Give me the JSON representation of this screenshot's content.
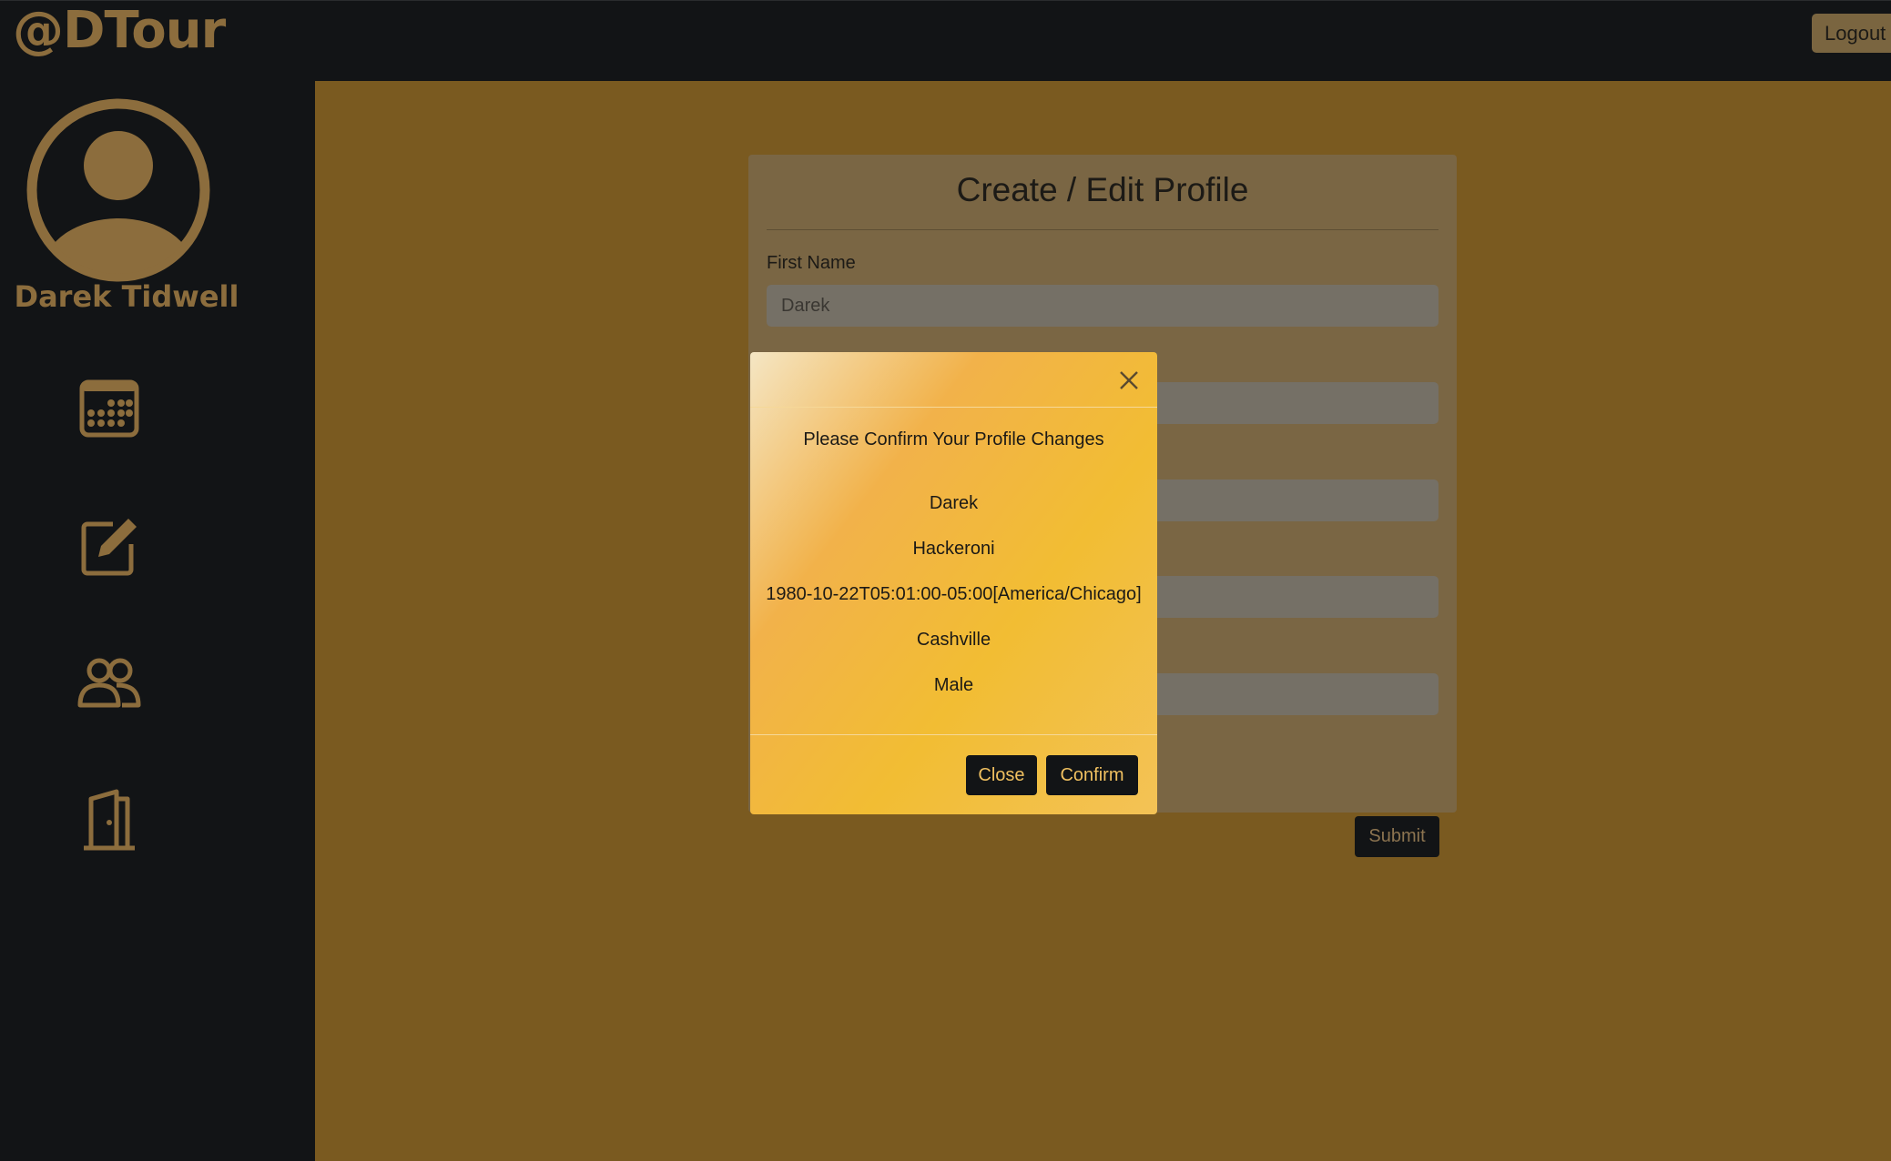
{
  "header": {
    "brand": "@DTour",
    "logout_label": "Logout"
  },
  "sidebar": {
    "user_name": "Darek Tidwell",
    "items": [
      {
        "icon": "calendar-icon"
      },
      {
        "icon": "edit-icon"
      },
      {
        "icon": "people-icon"
      },
      {
        "icon": "door-icon"
      }
    ]
  },
  "form": {
    "title": "Create / Edit Profile",
    "first_name_label": "First Name",
    "first_name_value": "Darek",
    "submit_label": "Submit"
  },
  "modal": {
    "title": "Please Confirm Your Profile Changes",
    "values": [
      "Darek",
      "Hackeroni",
      "1980-10-22T05:01:00-05:00[America/Chicago]",
      "Cashville",
      "Male"
    ],
    "close_label": "Close",
    "confirm_label": "Confirm"
  },
  "colors": {
    "accent": "#8c6d3d",
    "background": "#121416",
    "main_background": "#7a5a20",
    "modal_gradient_start": "#f4e6c4",
    "modal_gradient_end": "#f2bd33"
  }
}
